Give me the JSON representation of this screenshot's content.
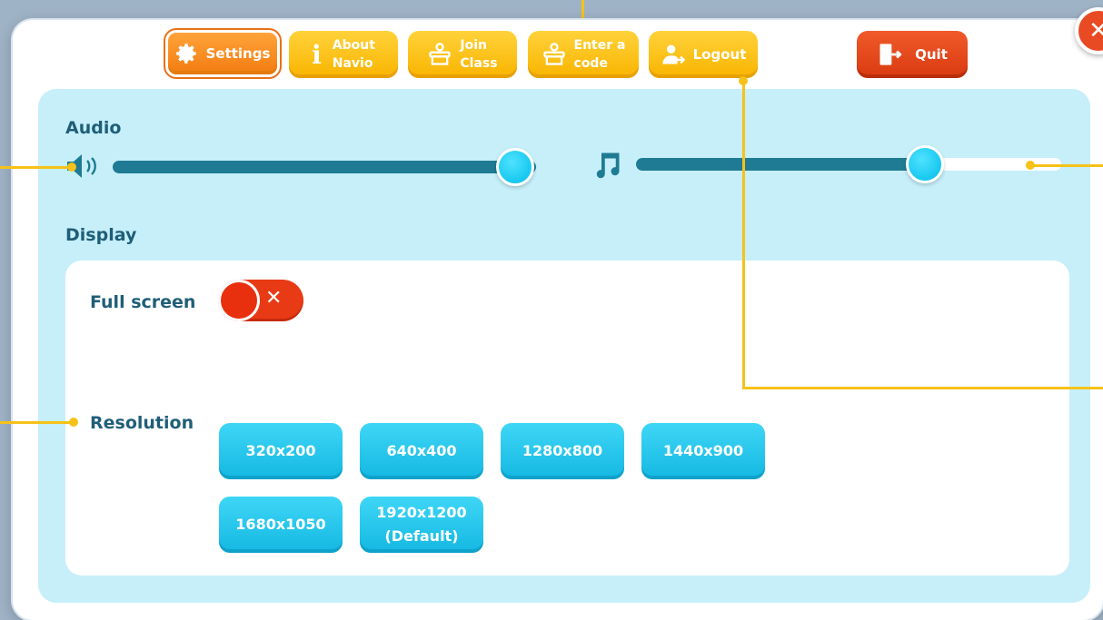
{
  "tabs": [
    {
      "label_line1": "Settings",
      "label_line2": ""
    },
    {
      "label_line1": "About",
      "label_line2": "Navio"
    },
    {
      "label_line1": "Join",
      "label_line2": "Class"
    },
    {
      "label_line1": "Enter a",
      "label_line2": "code"
    },
    {
      "label_line1": "Logout",
      "label_line2": ""
    },
    {
      "label_line1": "Quit",
      "label_line2": ""
    }
  ],
  "close_label": "✕",
  "audio": {
    "heading": "Audio",
    "sound_level": 0.95,
    "music_level": 0.68
  },
  "display": {
    "heading": "Display",
    "fullscreen_label": "Full screen",
    "fullscreen_on": false,
    "toggle_symbol": "✕",
    "resolution_label": "Resolution",
    "resolutions": [
      {
        "line1": "320x200",
        "line2": ""
      },
      {
        "line1": "640x400",
        "line2": ""
      },
      {
        "line1": "1280x800",
        "line2": ""
      },
      {
        "line1": "1440x900",
        "line2": ""
      },
      {
        "line1": "1680x1050",
        "line2": ""
      },
      {
        "line1": "1920x1200",
        "line2": "(Default)"
      }
    ]
  },
  "colors": {
    "tab_yellow": "#f9b400",
    "tab_active_orange": "#f27b10",
    "quit_red": "#d83a10",
    "panel_blue": "#c6effa",
    "accent_cyan": "#14b8e2",
    "text_teal": "#1f5e78",
    "callout_yellow": "#f6c21a"
  },
  "icons": {
    "settings": "gear-icon",
    "about": "info-icon",
    "join": "person-desk-icon",
    "code": "person-desk-icon",
    "logout": "user-exit-icon",
    "quit": "door-exit-icon",
    "sound": "speaker-icon",
    "music": "music-note-icon"
  }
}
